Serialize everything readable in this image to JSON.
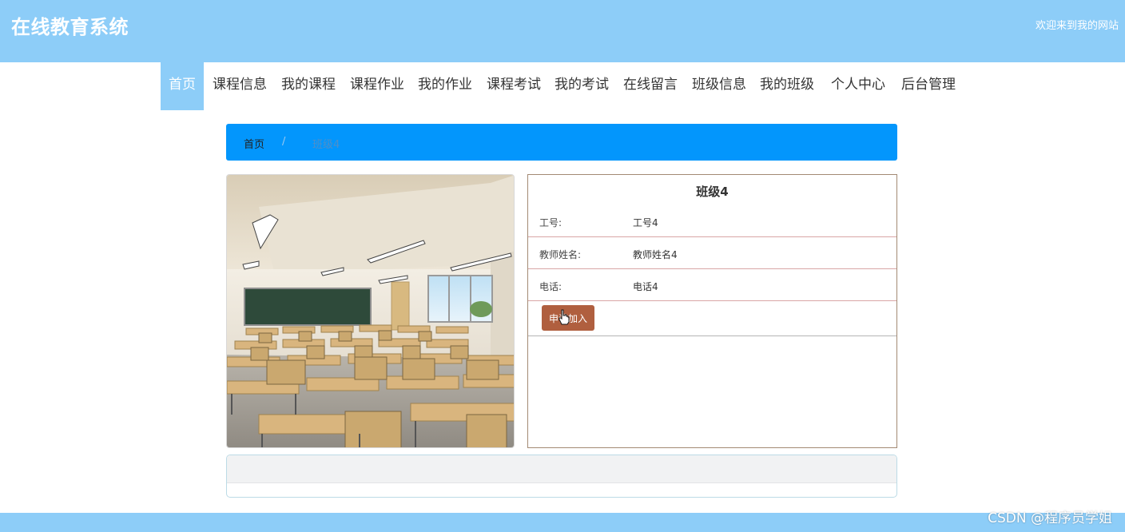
{
  "header": {
    "site_title": "在线教育系统",
    "welcome": "欢迎来到我的网站"
  },
  "nav": {
    "items": [
      {
        "label": "首页",
        "active": true
      },
      {
        "label": "课程信息"
      },
      {
        "label": "我的课程"
      },
      {
        "label": "课程作业"
      },
      {
        "label": "我的作业"
      },
      {
        "label": "课程考试"
      },
      {
        "label": "我的考试"
      },
      {
        "label": "在线留言"
      },
      {
        "label": "班级信息"
      },
      {
        "label": "我的班级"
      },
      {
        "label": "个人中心"
      },
      {
        "label": "后台管理"
      }
    ]
  },
  "breadcrumb": {
    "home": "首页",
    "separator": "/",
    "current": "班级4"
  },
  "detail": {
    "title": "班级4",
    "rows": [
      {
        "label": "工号:",
        "value": "工号4"
      },
      {
        "label": "教师姓名:",
        "value": "教师姓名4"
      },
      {
        "label": "电话:",
        "value": "电话4"
      }
    ],
    "apply_button": "申请加入"
  },
  "colors": {
    "header_bg": "#8dcdf8",
    "breadcrumb_bg": "#0396fc",
    "apply_button_bg": "#b05f3f"
  },
  "icons": {
    "cursor": "hand-pointer-icon",
    "photo": "classroom-image"
  },
  "watermark": "CSDN @程序员学姐"
}
